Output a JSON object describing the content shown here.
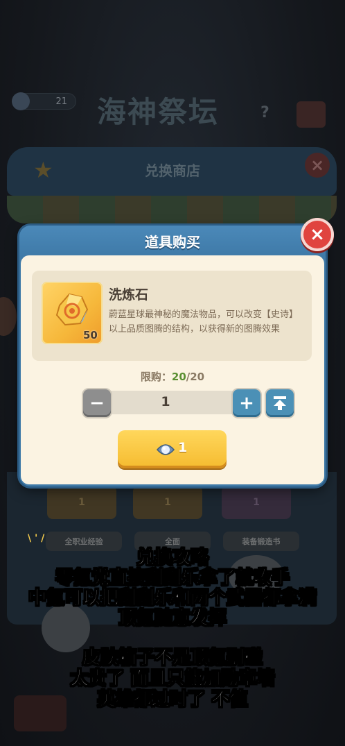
{
  "background": {
    "currency_value": "21",
    "title": "海神祭坛",
    "help": "?",
    "shop_title": "兑换商店",
    "card_costs": [
      "1",
      "1",
      "1"
    ],
    "card_labels": [
      "全职业经验",
      "全面",
      "装备锻造书"
    ]
  },
  "modal": {
    "title": "道具购买",
    "close_icon": "×",
    "item": {
      "name": "洗炼石",
      "description": "蔚蓝星球最神秘的魔法物品，可以改变【史诗】以上品质图腾的结构，以获得新的图腾效果",
      "count": "50"
    },
    "limit": {
      "label": "限购：",
      "current": "20",
      "max": "/20"
    },
    "quantity": "1",
    "minus_icon": "−",
    "plus_icon": "+",
    "buy_cost": "1"
  },
  "captions": {
    "group1": [
      "兑换攻略",
      "零氪党直接刮刮乐拿了就收手",
      "中氪可以把刮刮乐和两个武器都拿满",
      "顶氪随意发挥"
    ],
    "group2": [
      "皮肤箱子不是顶氪别碰",
      "太贵了 而且只能加勋章墙",
      "英雄都过时了 不值"
    ]
  },
  "colors": {
    "modal_blue": "#3f7aa8",
    "buy_button": "#f5bb2f",
    "close_red": "#e0443f",
    "limit_green": "#5a8f32"
  }
}
